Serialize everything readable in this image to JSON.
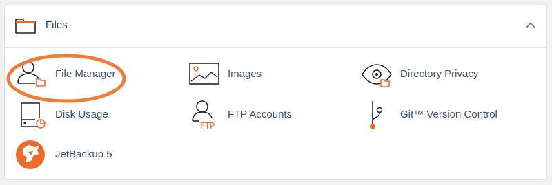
{
  "section": {
    "title": "Files",
    "icon": "folder-icon",
    "collapse_icon": "chevron-up-icon"
  },
  "accent_color": "#ee6c2b",
  "text_color": "#3a5270",
  "tools": [
    {
      "label": "File Manager",
      "icon": "file-manager-icon",
      "highlighted": true
    },
    {
      "label": "Images",
      "icon": "image-icon"
    },
    {
      "label": "Directory Privacy",
      "icon": "directory-privacy-icon"
    },
    {
      "label": "Disk Usage",
      "icon": "disk-usage-icon"
    },
    {
      "label": "FTP Accounts",
      "icon": "ftp-accounts-icon"
    },
    {
      "label": "Git™ Version Control",
      "icon": "git-version-control-icon"
    },
    {
      "label": "JetBackup 5",
      "icon": "jetbackup-icon"
    }
  ]
}
